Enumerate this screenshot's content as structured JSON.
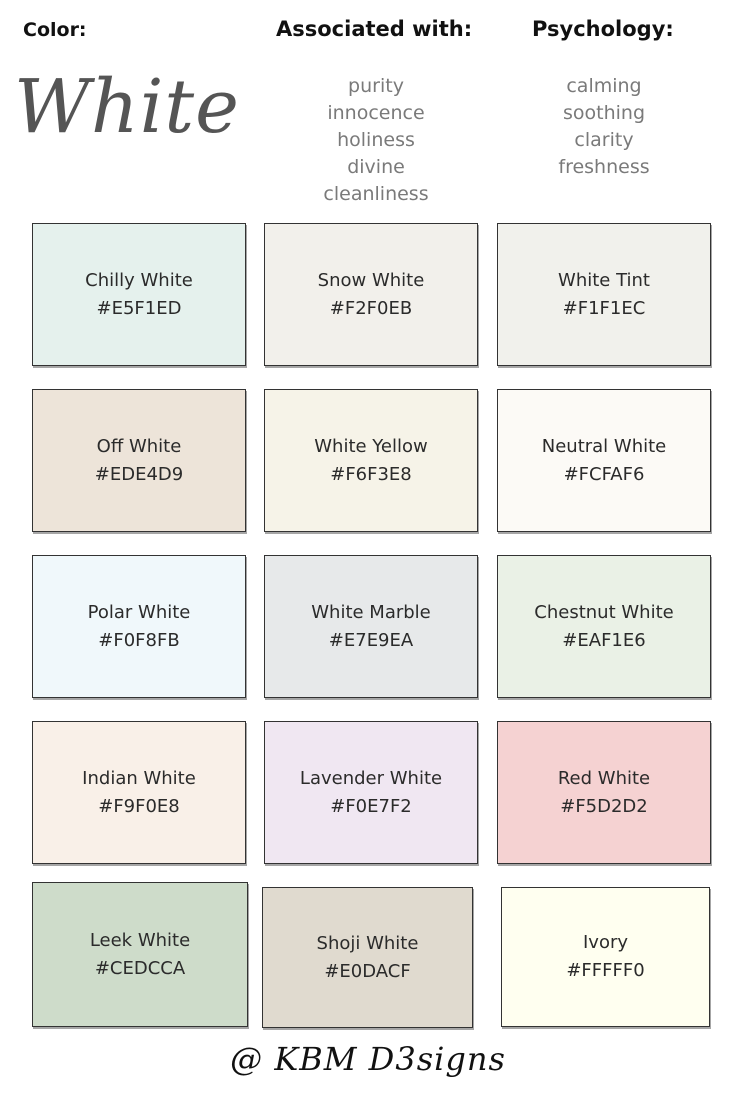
{
  "header": {
    "color_label": "Color:",
    "associated_label": "Associated with:",
    "psychology_label": "Psychology:"
  },
  "title": "White",
  "associated": [
    "purity",
    "innocence",
    "holiness",
    "divine",
    "cleanliness"
  ],
  "psychology": [
    "calming",
    "soothing",
    "clarity",
    "freshness"
  ],
  "swatches": [
    {
      "name": "Chilly White",
      "hex": "#E5F1ED",
      "color": "#E5F1ED"
    },
    {
      "name": "Snow White",
      "hex": "#F2F0EB",
      "color": "#F2F0EB"
    },
    {
      "name": "White Tint",
      "hex": "#F1F1EC",
      "color": "#F1F1EC"
    },
    {
      "name": "Off White",
      "hex": "#EDE4D9",
      "color": "#EDE4D9"
    },
    {
      "name": "White Yellow",
      "hex": "#F6F3E8",
      "color": "#F6F3E8"
    },
    {
      "name": "Neutral White",
      "hex": "#FCFAF6",
      "color": "#FCFAF6"
    },
    {
      "name": "Polar White",
      "hex": "#F0F8FB",
      "color": "#F0F8FB"
    },
    {
      "name": "White Marble",
      "hex": "#E7E9EA",
      "color": "#E7E9EA"
    },
    {
      "name": "Chestnut White",
      "hex": "#EAF1E6",
      "color": "#EAF1E6"
    },
    {
      "name": "Indian White",
      "hex": "#F9F0E8",
      "color": "#F9F0E8"
    },
    {
      "name": "Lavender White",
      "hex": "#F0E7F2",
      "color": "#F0E7F2"
    },
    {
      "name": "Red White",
      "hex": "#F5D2D2",
      "color": "#F5D2D2"
    },
    {
      "name": "Leek White",
      "hex": "#CEDCCA",
      "color": "#CEDCCA"
    },
    {
      "name": "Shoji White",
      "hex": "#E0DACF",
      "color": "#E0DACF"
    },
    {
      "name": "Ivory",
      "hex": "#FFFFF0",
      "color": "#FFFFF0"
    }
  ],
  "footer": "@ KBM D3signs"
}
